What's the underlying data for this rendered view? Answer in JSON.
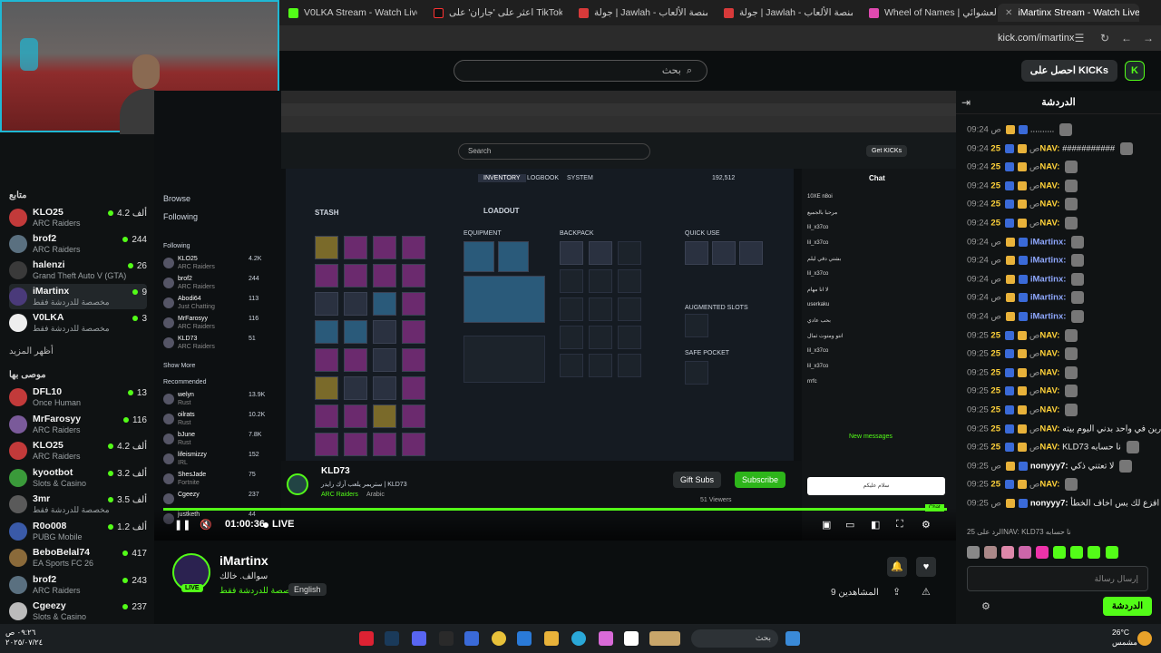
{
  "browser": {
    "tabs": [
      {
        "label": "V0LKA Stream - Watch Live on"
      },
      {
        "label": "اعثر على 'جاران' على TikTok"
      },
      {
        "label": "جولة | Jawlah - منصة الألعاب"
      },
      {
        "label": "جولة | Jawlah - منصة الألعاب"
      },
      {
        "label": "Wheel of Names | اسم العشوائي"
      },
      {
        "label": "iMartinx Stream - Watch Live on"
      }
    ],
    "url": "kick.com/imartinx"
  },
  "header": {
    "search_placeholder": "بحث",
    "get_kicks": "احصل على KICKs"
  },
  "sidebar": {
    "following_title": "متابع",
    "show_more": "أظهر المزيد",
    "recommended_title": "موصى بها",
    "following": [
      {
        "name": "KLO25",
        "category": "ARC Raiders",
        "viewers": "4.2 ألف",
        "color": "#c23a3a"
      },
      {
        "name": "brof2",
        "category": "ARC Raiders",
        "viewers": "244",
        "color": "#5a7080"
      },
      {
        "name": "halenzi",
        "category": "Grand Theft Auto V (GTA)",
        "viewers": "26",
        "color": "#3a3a3a"
      },
      {
        "name": "iMartinx",
        "category": "مخصصة للدردشة فقط",
        "viewers": "9",
        "color": "#4a3a7a"
      },
      {
        "name": "V0LKA",
        "category": "مخصصة للدردشة فقط",
        "viewers": "3",
        "color": "#eeeeee"
      }
    ],
    "recommended": [
      {
        "name": "DFL10",
        "category": "Once Human",
        "viewers": "13",
        "color": "#c23a3a"
      },
      {
        "name": "MrFarosyy",
        "category": "ARC Raiders",
        "viewers": "116",
        "color": "#7a5a9a"
      },
      {
        "name": "KLO25",
        "category": "ARC Raiders",
        "viewers": "4.2 ألف",
        "color": "#c23a3a"
      },
      {
        "name": "kyootbot",
        "category": "Slots & Casino",
        "viewers": "3.2 ألف",
        "color": "#3a9a3a"
      },
      {
        "name": "3mr",
        "category": "مخصصة للدردشة فقط",
        "viewers": "3.5 ألف",
        "color": "#5a5a5a"
      },
      {
        "name": "R0o008",
        "category": "PUBG Mobile",
        "viewers": "1.2 ألف",
        "color": "#3a5aa8"
      },
      {
        "name": "BeboBelal74",
        "category": "EA Sports FC 26",
        "viewers": "417",
        "color": "#8a6a3a"
      },
      {
        "name": "brof2",
        "category": "ARC Raiders",
        "viewers": "243",
        "color": "#5a7080"
      },
      {
        "name": "Cgeezy",
        "category": "Slots & Casino",
        "viewers": "237",
        "color": "#bbbbbb"
      }
    ]
  },
  "stream": {
    "inner": {
      "search": "Search",
      "get_kicks": "Get KICKs",
      "browse": "Browse",
      "following": "Following",
      "following_title": "Following",
      "show_more": "Show More",
      "recommended_title": "Recommended",
      "tabs": [
        "INVENTORY",
        "LOGBOOK",
        "SYSTEM"
      ],
      "stash": "STASH",
      "loadout": "LOADOUT",
      "equipment": "EQUIPMENT",
      "backpack": "BACKPACK",
      "quick_use": "QUICK USE",
      "augmented_slots": "AUGMENTED SLOTS",
      "safe_pocket": "SAFE POCKET",
      "coins": "192,512",
      "chat_title": "Chat",
      "new_messages": "New messages",
      "chat_input": "سلام عليكم",
      "chat_btn": "Chat",
      "streamer": "KLD73",
      "stream_title": "ستريمر يلعب آرك رايدر | KLD73",
      "stream_cat": "ARC Raiders",
      "stream_lang": "Arabic",
      "gift_subs": "Gift Subs",
      "subscribe": "Subscribe",
      "viewers": "51 Viewers",
      "inner_chat": [
        "10XE  n8oi",
        "مرحبا بالجميع",
        "lil_x37co",
        "lil_x37co",
        "بشتي دقي ليلم",
        "lil_x37co",
        "لا انا مهام",
        "userkaku",
        "بحب عادي",
        "انتو ومتوت ثمال",
        "lil_x37co",
        "lil_x37co",
        "rrrfc"
      ],
      "side_following": [
        {
          "name": "KLO25",
          "category": "ARC Raiders",
          "viewers": "4.2K"
        },
        {
          "name": "brof2",
          "category": "ARC Raiders",
          "viewers": "244"
        },
        {
          "name": "Abodi64",
          "category": "Just Chatting",
          "viewers": "113"
        },
        {
          "name": "MrFarosyy",
          "category": "ARC Raiders",
          "viewers": "116"
        },
        {
          "name": "KLD73",
          "category": "ARC Raiders",
          "viewers": "51"
        }
      ],
      "side_recommended": [
        {
          "name": "welyn",
          "category": "Rust",
          "viewers": "13.9K"
        },
        {
          "name": "oilrats",
          "category": "Rust",
          "viewers": "10.2K"
        },
        {
          "name": "bJune",
          "category": "Rust",
          "viewers": "7.8K"
        },
        {
          "name": "lifeismizzy",
          "category": "IRL",
          "viewers": "152"
        },
        {
          "name": "ShesJade",
          "category": "Fortnite",
          "viewers": "75"
        },
        {
          "name": "Cgeezy",
          "category": "",
          "viewers": "237"
        },
        {
          "name": "justketh",
          "category": "",
          "viewers": "44"
        }
      ]
    },
    "player": {
      "time": "01:00:36",
      "live": "LIVE"
    }
  },
  "channel": {
    "name": "iMartinx",
    "title": "سوالف. خالك",
    "category": "مخصصة للدردشة فقط",
    "language": "English",
    "followers": "9 المشاهدين",
    "live": "LIVE"
  },
  "chat": {
    "title": "الدردشة",
    "input_placeholder": "إرسال رسالة",
    "send": "الدردشة",
    "messages": [
      {
        "time": "09:24 ص",
        "user": "",
        "text": "..........",
        "color": "#ffd23a"
      },
      {
        "time": "09:24 ص",
        "user": "25NAV:",
        "text": "###########",
        "color": "#ffd23a"
      },
      {
        "time": "09:24 ص",
        "user": "25NAV:",
        "text": "",
        "color": "#ffd23a"
      },
      {
        "time": "09:24 ص",
        "user": "25NAV:",
        "text": "",
        "color": "#ffd23a"
      },
      {
        "time": "09:24 ص",
        "user": "25NAV:",
        "text": "",
        "color": "#ffd23a"
      },
      {
        "time": "09:24 ص",
        "user": "25NAV:",
        "text": "",
        "color": "#ffd23a"
      },
      {
        "time": "09:24 ص",
        "user": "iMartinx:",
        "text": "",
        "color": "#8fa8ff"
      },
      {
        "time": "09:24 ص",
        "user": "iMartinx:",
        "text": "",
        "color": "#8fa8ff"
      },
      {
        "time": "09:24 ص",
        "user": "iMartinx:",
        "text": "",
        "color": "#8fa8ff"
      },
      {
        "time": "09:24 ص",
        "user": "iMartinx:",
        "text": "",
        "color": "#8fa8ff"
      },
      {
        "time": "09:24 ص",
        "user": "iMartinx:",
        "text": "",
        "color": "#8fa8ff"
      },
      {
        "time": "09:25 ص",
        "user": "25NAV:",
        "text": "",
        "color": "#ffd23a"
      },
      {
        "time": "09:25 ص",
        "user": "25NAV:",
        "text": "",
        "color": "#ffd23a"
      },
      {
        "time": "09:25 ص",
        "user": "25NAV:",
        "text": "",
        "color": "#ffd23a"
      },
      {
        "time": "09:25 ص",
        "user": "25NAV:",
        "text": "",
        "color": "#ffd23a"
      },
      {
        "time": "09:25 ص",
        "user": "25NAV:",
        "text": "",
        "color": "#ffd23a"
      },
      {
        "time": "09:25 ص",
        "user": "25NAV:",
        "text": "مارين في واحد بدني اليوم بيته",
        "color": "#ffd23a"
      },
      {
        "time": "09:25 ص",
        "user": "25NAV:",
        "text": "KLD73 نا حسابه",
        "color": "#ffd23a"
      },
      {
        "time": "09:25 ص",
        "user": "nonyyy7:",
        "text": "لا تعتني ذكي",
        "color": "#ffffff"
      },
      {
        "time": "09:25 ص",
        "user": "25NAV:",
        "text": "",
        "color": "#ffd23a"
      },
      {
        "time": "09:25 ص",
        "user": "nonyyy7:",
        "text": "ودي افزع لك بس اخاف الخطأ",
        "color": "#ffffff"
      }
    ],
    "reply_hint": "الرد على 25NAV: KLD73 نا حسابه"
  },
  "taskbar": {
    "search": "بحث",
    "clock_time": "٠٩:٢٦ ص",
    "clock_date": "٢٠٢٥/٠٧/٢٤",
    "temp": "26°C",
    "weather": "مشمس"
  }
}
